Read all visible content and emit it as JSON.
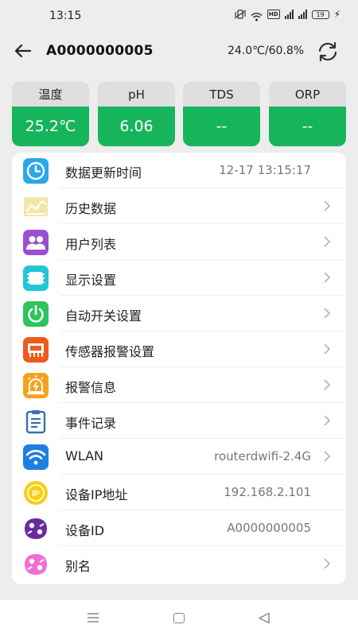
{
  "status_bar": {
    "time": "13:15",
    "battery": "19"
  },
  "header": {
    "title": "A0000000005",
    "readout": "24.0℃/60.8%"
  },
  "sensors": [
    {
      "label": "温度",
      "value": "25.2℃"
    },
    {
      "label": "pH",
      "value": "6.06"
    },
    {
      "label": "TDS",
      "value": "--"
    },
    {
      "label": "ORP",
      "value": "--"
    }
  ],
  "menu": [
    {
      "label": "数据更新时间",
      "value": "12-17 13:15:17",
      "icon": "clock-icon"
    },
    {
      "label": "历史数据",
      "icon": "history-chart-icon"
    },
    {
      "label": "用户列表",
      "icon": "users-icon"
    },
    {
      "label": "显示设置",
      "icon": "display-icon"
    },
    {
      "label": "自动开关设置",
      "icon": "power-icon"
    },
    {
      "label": "传感器报警设置",
      "icon": "sensor-alarm-icon"
    },
    {
      "label": "报警信息",
      "icon": "alarm-icon"
    },
    {
      "label": "事件记录",
      "icon": "clipboard-icon"
    },
    {
      "label": "WLAN",
      "value": "routerdwifi-2.4G",
      "icon": "wifi-icon"
    },
    {
      "label": "设备IP地址",
      "value": "192.168.2.101",
      "icon": "ip-icon"
    },
    {
      "label": "设备ID",
      "value": "A0000000005",
      "icon": "device-id-icon"
    },
    {
      "label": "别名",
      "icon": "alias-icon"
    }
  ],
  "colors": {
    "sensor_green": "#17b55b",
    "background": "#ededed"
  }
}
